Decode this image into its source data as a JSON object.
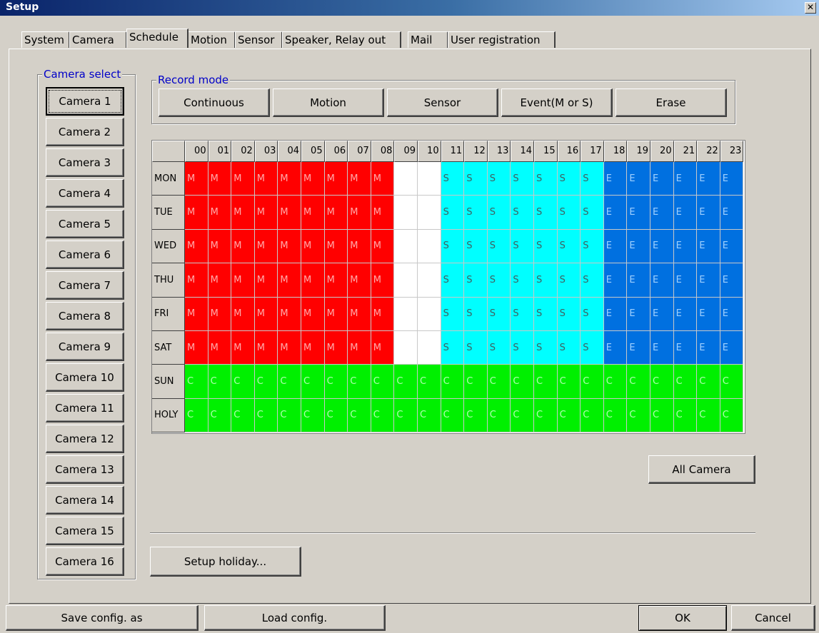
{
  "window": {
    "title": "Setup",
    "close_glyph": "✕"
  },
  "tabs": [
    {
      "label": "System"
    },
    {
      "label": "Camera"
    },
    {
      "label": "Schedule"
    },
    {
      "label": "Motion"
    },
    {
      "label": "Sensor"
    },
    {
      "label": "Speaker, Relay out"
    },
    {
      "label": "Mail"
    },
    {
      "label": "User registration"
    }
  ],
  "active_tab": "Schedule",
  "camera_select": {
    "legend": "Camera select",
    "cameras": [
      "Camera 1",
      "Camera 2",
      "Camera 3",
      "Camera 4",
      "Camera 5",
      "Camera 6",
      "Camera 7",
      "Camera 8",
      "Camera 9",
      "Camera 10",
      "Camera 11",
      "Camera 12",
      "Camera 13",
      "Camera 14",
      "Camera 15",
      "Camera 16"
    ],
    "selected": "Camera 1"
  },
  "record_mode": {
    "legend": "Record mode",
    "buttons": [
      "Continuous",
      "Motion",
      "Sensor",
      "Event(M or S)",
      "Erase"
    ]
  },
  "schedule": {
    "hours": [
      "00",
      "01",
      "02",
      "03",
      "04",
      "05",
      "06",
      "07",
      "08",
      "09",
      "10",
      "11",
      "12",
      "13",
      "14",
      "15",
      "16",
      "17",
      "18",
      "19",
      "20",
      "21",
      "22",
      "23"
    ],
    "days": [
      "MON",
      "TUE",
      "WED",
      "THU",
      "FRI",
      "SAT",
      "SUN",
      "HOLY"
    ],
    "modes": {
      "M": {
        "label": "M",
        "color": "#ff0000",
        "text_color": "#ffaaaa"
      },
      "S": {
        "label": "S",
        "color": "#00ffff",
        "text_color": "#406060"
      },
      "E": {
        "label": "E",
        "color": "#0070e0",
        "text_color": "#9fd0ff"
      },
      "C": {
        "label": "C",
        "color": "#00f000",
        "text_color": "#b0ffb0"
      },
      "-": {
        "label": "",
        "color": "#ffffff",
        "text_color": "#000000"
      }
    },
    "rows": [
      [
        "M",
        "M",
        "M",
        "M",
        "M",
        "M",
        "M",
        "M",
        "M",
        "-",
        "-",
        "S",
        "S",
        "S",
        "S",
        "S",
        "S",
        "S",
        "E",
        "E",
        "E",
        "E",
        "E",
        "E"
      ],
      [
        "M",
        "M",
        "M",
        "M",
        "M",
        "M",
        "M",
        "M",
        "M",
        "-",
        "-",
        "S",
        "S",
        "S",
        "S",
        "S",
        "S",
        "S",
        "E",
        "E",
        "E",
        "E",
        "E",
        "E"
      ],
      [
        "M",
        "M",
        "M",
        "M",
        "M",
        "M",
        "M",
        "M",
        "M",
        "-",
        "-",
        "S",
        "S",
        "S",
        "S",
        "S",
        "S",
        "S",
        "E",
        "E",
        "E",
        "E",
        "E",
        "E"
      ],
      [
        "M",
        "M",
        "M",
        "M",
        "M",
        "M",
        "M",
        "M",
        "M",
        "-",
        "-",
        "S",
        "S",
        "S",
        "S",
        "S",
        "S",
        "S",
        "E",
        "E",
        "E",
        "E",
        "E",
        "E"
      ],
      [
        "M",
        "M",
        "M",
        "M",
        "M",
        "M",
        "M",
        "M",
        "M",
        "-",
        "-",
        "S",
        "S",
        "S",
        "S",
        "S",
        "S",
        "S",
        "E",
        "E",
        "E",
        "E",
        "E",
        "E"
      ],
      [
        "M",
        "M",
        "M",
        "M",
        "M",
        "M",
        "M",
        "M",
        "M",
        "-",
        "-",
        "S",
        "S",
        "S",
        "S",
        "S",
        "S",
        "S",
        "E",
        "E",
        "E",
        "E",
        "E",
        "E"
      ],
      [
        "C",
        "C",
        "C",
        "C",
        "C",
        "C",
        "C",
        "C",
        "C",
        "C",
        "C",
        "C",
        "C",
        "C",
        "C",
        "C",
        "C",
        "C",
        "C",
        "C",
        "C",
        "C",
        "C",
        "C"
      ],
      [
        "C",
        "C",
        "C",
        "C",
        "C",
        "C",
        "C",
        "C",
        "C",
        "C",
        "C",
        "C",
        "C",
        "C",
        "C",
        "C",
        "C",
        "C",
        "C",
        "C",
        "C",
        "C",
        "C",
        "C"
      ]
    ]
  },
  "all_camera_label": "All Camera",
  "setup_holiday_label": "Setup holiday...",
  "footer": {
    "save_label": "Save config. as",
    "load_label": "Load config.",
    "ok_label": "OK",
    "cancel_label": "Cancel"
  }
}
